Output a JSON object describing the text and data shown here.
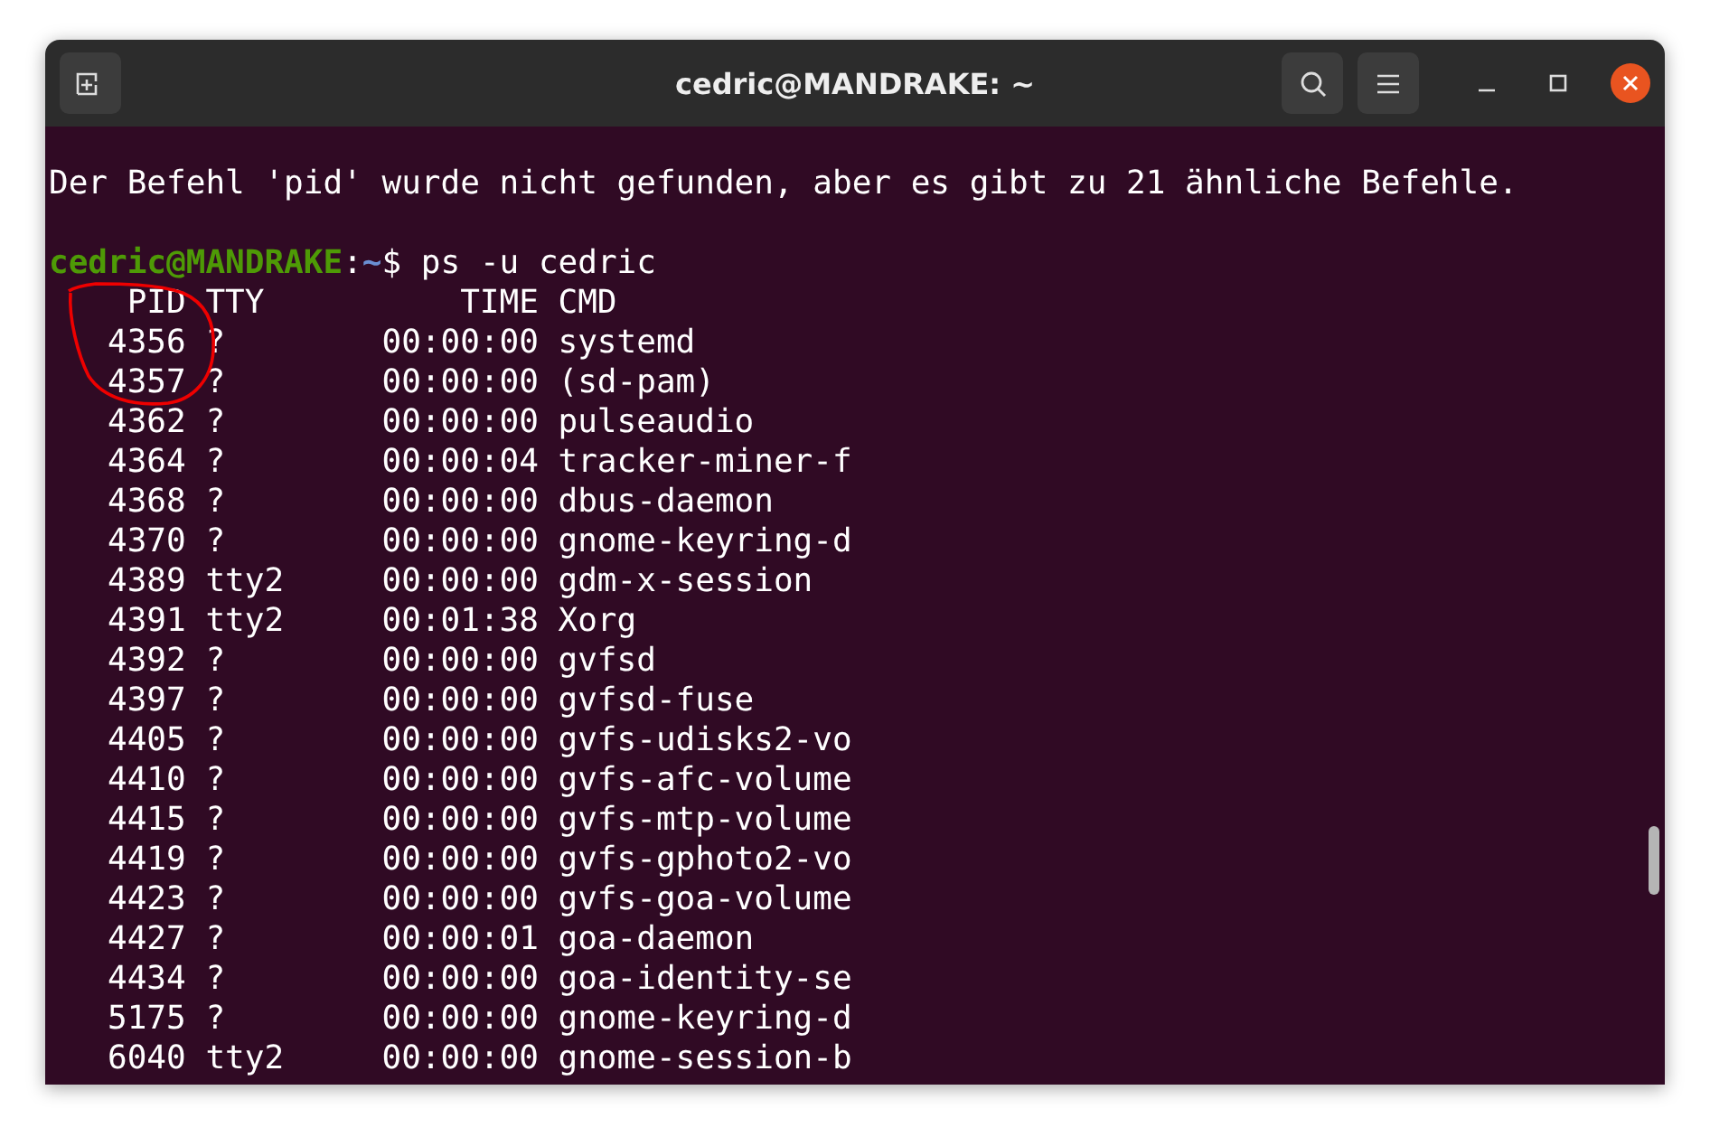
{
  "window": {
    "title": "cedric@MANDRAKE: ~"
  },
  "terminal": {
    "lines": [
      {
        "kind": "output",
        "text": "Der Befehl 'pid' wurde nicht gefunden, aber es gibt zu 21 ähnliche Befehle."
      },
      {
        "kind": "blank"
      },
      {
        "kind": "prompt",
        "user_host": "cedric@MANDRAKE",
        "separator": ":",
        "path": "~",
        "symbol": "$",
        "command": " ps -u cedric"
      },
      {
        "kind": "output",
        "text": "    PID TTY          TIME CMD"
      },
      {
        "kind": "output",
        "text": "   4356 ?        00:00:00 systemd"
      },
      {
        "kind": "output",
        "text": "   4357 ?        00:00:00 (sd-pam)"
      },
      {
        "kind": "output",
        "text": "   4362 ?        00:00:00 pulseaudio"
      },
      {
        "kind": "output",
        "text": "   4364 ?        00:00:04 tracker-miner-f"
      },
      {
        "kind": "output",
        "text": "   4368 ?        00:00:00 dbus-daemon"
      },
      {
        "kind": "output",
        "text": "   4370 ?        00:00:00 gnome-keyring-d"
      },
      {
        "kind": "output",
        "text": "   4389 tty2     00:00:00 gdm-x-session"
      },
      {
        "kind": "output",
        "text": "   4391 tty2     00:01:38 Xorg"
      },
      {
        "kind": "output",
        "text": "   4392 ?        00:00:00 gvfsd"
      },
      {
        "kind": "output",
        "text": "   4397 ?        00:00:00 gvfsd-fuse"
      },
      {
        "kind": "output",
        "text": "   4405 ?        00:00:00 gvfs-udisks2-vo"
      },
      {
        "kind": "output",
        "text": "   4410 ?        00:00:00 gvfs-afc-volume"
      },
      {
        "kind": "output",
        "text": "   4415 ?        00:00:00 gvfs-mtp-volume"
      },
      {
        "kind": "output",
        "text": "   4419 ?        00:00:00 gvfs-gphoto2-vo"
      },
      {
        "kind": "output",
        "text": "   4423 ?        00:00:00 gvfs-goa-volume"
      },
      {
        "kind": "output",
        "text": "   4427 ?        00:00:01 goa-daemon"
      },
      {
        "kind": "output",
        "text": "   4434 ?        00:00:00 goa-identity-se"
      },
      {
        "kind": "output",
        "text": "   5175 ?        00:00:00 gnome-keyring-d"
      },
      {
        "kind": "output",
        "text": "   6040 tty2     00:00:00 gnome-session-b"
      }
    ]
  }
}
